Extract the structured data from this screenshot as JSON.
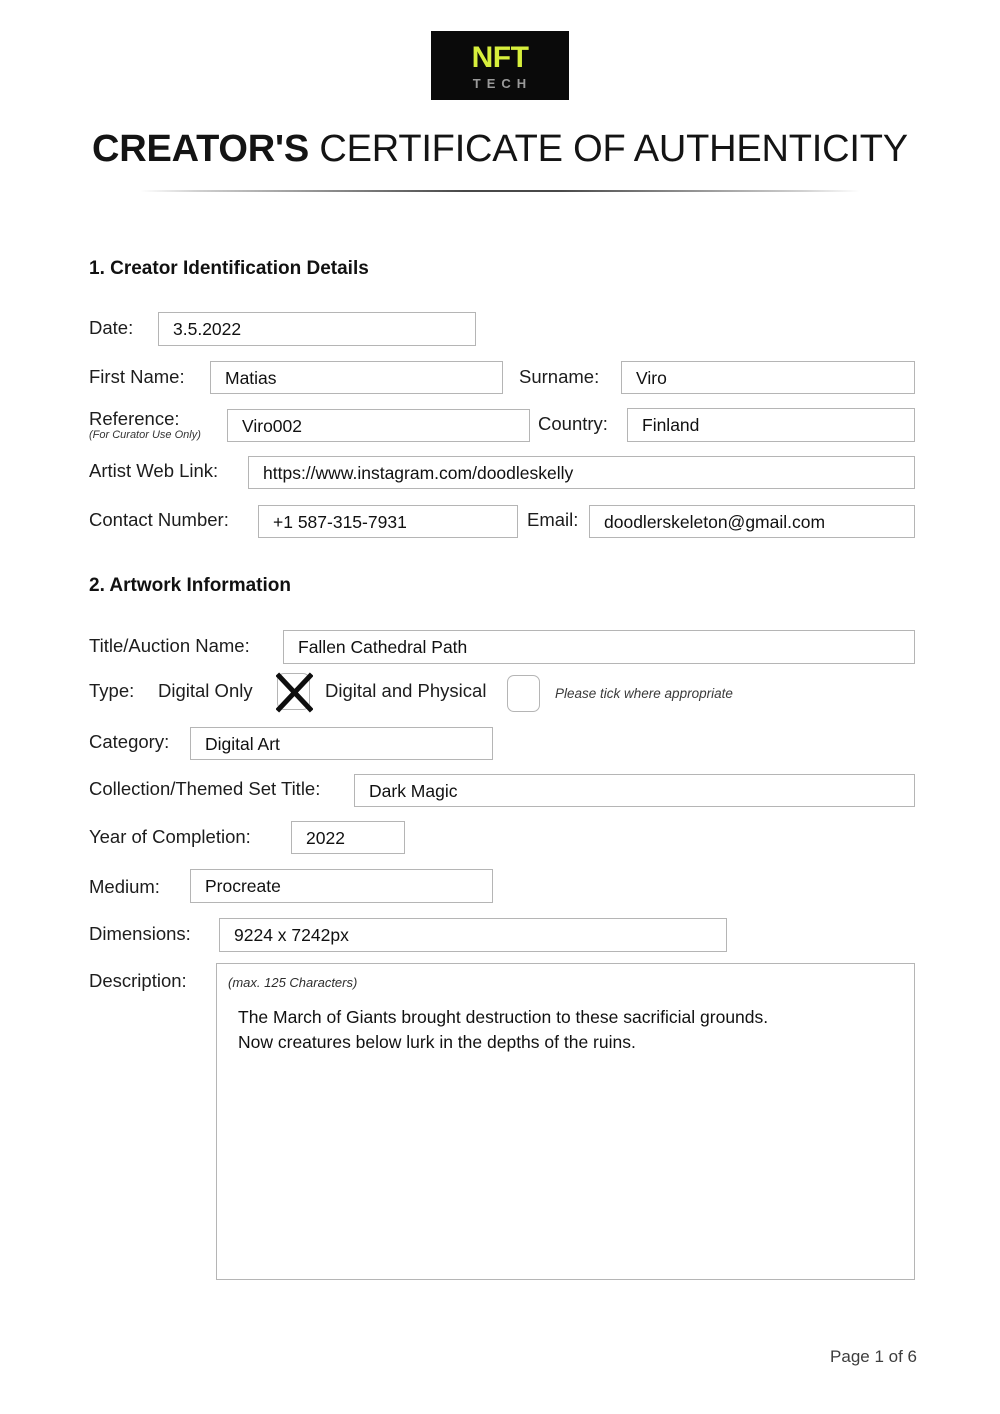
{
  "logo": {
    "primary_text": "NFT",
    "secondary_text": "TECH",
    "primary_color": "#d7ef3c",
    "secondary_color": "#9a9a9a",
    "background_color": "#0a0a0a"
  },
  "title": {
    "bold_part": "CREATOR'S",
    "regular_part": " CERTIFICATE OF AUTHENTICITY"
  },
  "section1": {
    "heading": "1. Creator Identification Details",
    "fields": {
      "date_label": "Date:",
      "date_value": "3.5.2022",
      "first_name_label": "First Name:",
      "first_name_value": "Matias",
      "surname_label": "Surname:",
      "surname_value": "Viro",
      "reference_label": "Reference:",
      "reference_sublabel": "(For Curator Use Only)",
      "reference_value": "Viro002",
      "country_label": "Country:",
      "country_value": "Finland",
      "web_link_label": "Artist Web Link:",
      "web_link_value": "https://www.instagram.com/doodleskelly",
      "contact_number_label": "Contact Number:",
      "contact_number_value": "+1 587-315-7931",
      "email_label": "Email:",
      "email_value": "doodlerskeleton@gmail.com"
    }
  },
  "section2": {
    "heading": "2. Artwork Information",
    "fields": {
      "title_label": "Title/Auction Name:",
      "title_value": "Fallen Cathedral Path",
      "type_label": "Type:",
      "type_option_digital_only": "Digital Only",
      "type_option_digital_physical": "Digital and Physical",
      "type_note": "Please tick where appropriate",
      "type_digital_only_checked": true,
      "type_digital_physical_checked": false,
      "category_label": "Category:",
      "category_value": "Digital Art",
      "collection_label": "Collection/Themed Set Title:",
      "collection_value": "Dark Magic",
      "year_label": "Year of Completion:",
      "year_value": "2022",
      "medium_label": "Medium:",
      "medium_value": "Procreate",
      "dimensions_label": "Dimensions:",
      "dimensions_value": "9224 x 7242px",
      "description_label": "Description:",
      "description_hint": "(max. 125 Characters)",
      "description_value": "The March of Giants brought destruction to these sacrificial grounds.\nNow creatures below lurk in the depths of the ruins."
    }
  },
  "footer": {
    "page_indicator": "Page 1 of 6"
  }
}
